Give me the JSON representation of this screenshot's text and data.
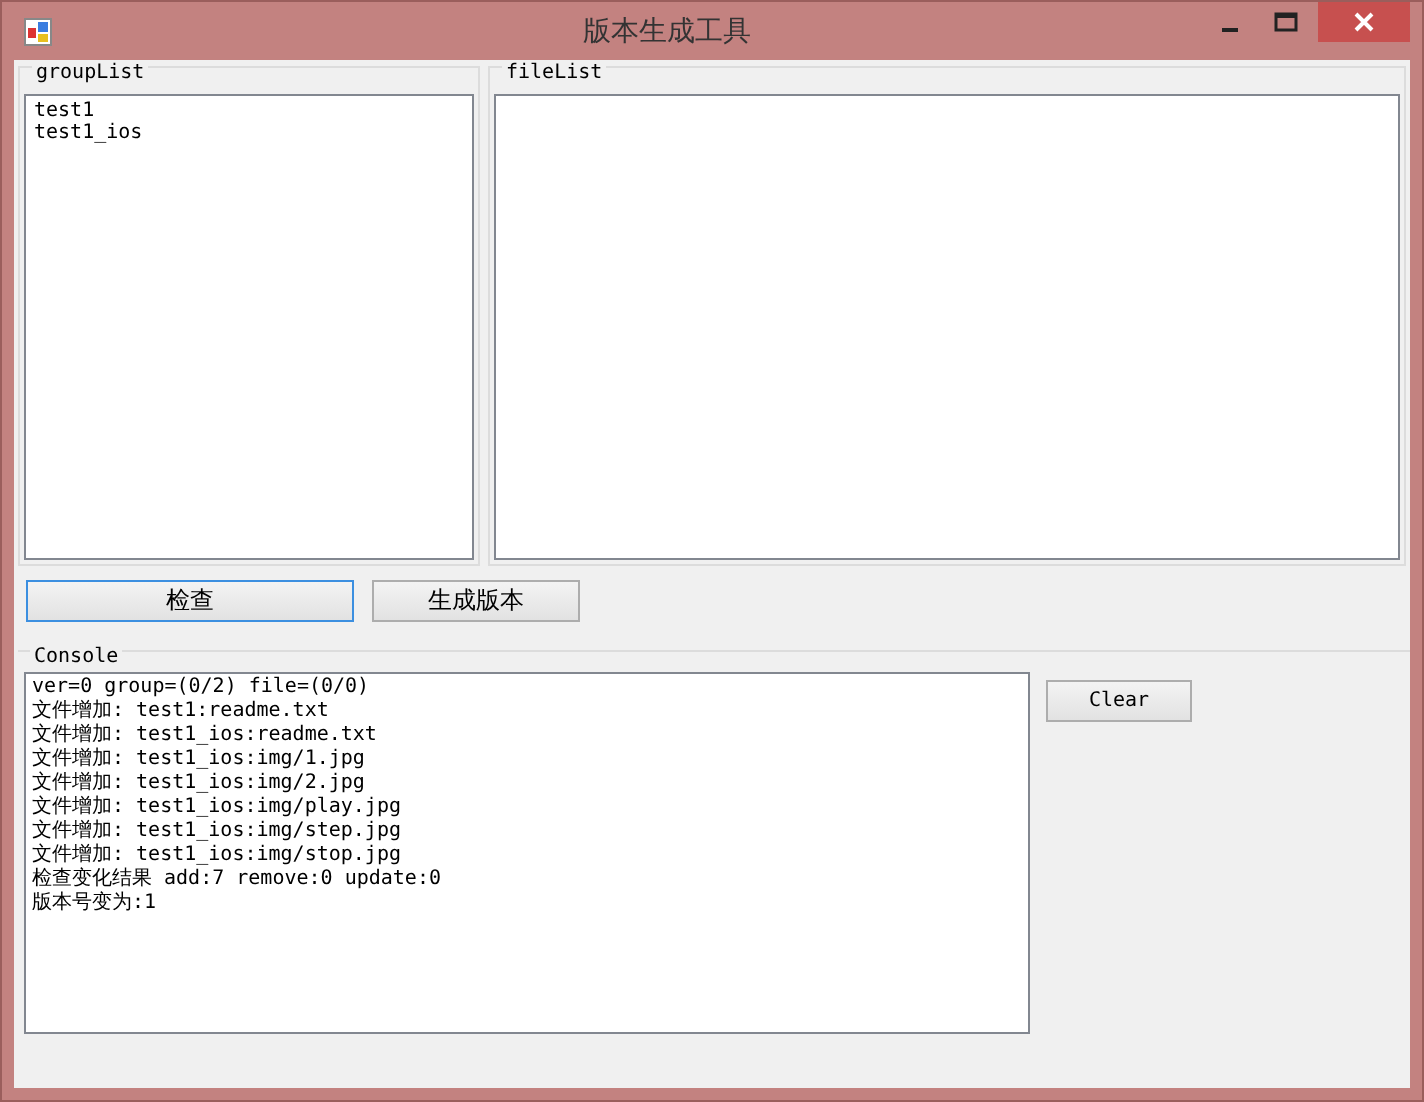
{
  "window": {
    "title": "版本生成工具"
  },
  "group_list": {
    "title": "groupList",
    "items": [
      {
        "label": "test1"
      },
      {
        "label": "test1_ios"
      }
    ]
  },
  "file_list": {
    "title": "fileList"
  },
  "buttons": [
    {
      "label": "检查",
      "focused": true
    },
    {
      "label": "生成版本",
      "focused": false
    }
  ],
  "console": {
    "title": "Console",
    "lines": [
      "ver=0 group=(0/2) file=(0/0)",
      "文件增加: test1:readme.txt",
      "文件增加: test1_ios:readme.txt",
      "文件增加: test1_ios:img/1.jpg",
      "文件增加: test1_ios:img/2.jpg",
      "文件增加: test1_ios:img/play.jpg",
      "文件增加: test1_ios:img/step.jpg",
      "文件增加: test1_ios:img/stop.jpg",
      "检查变化结果 add:7 remove:0 update:0",
      "版本号变为:1"
    ],
    "clear_button": "Clear"
  }
}
